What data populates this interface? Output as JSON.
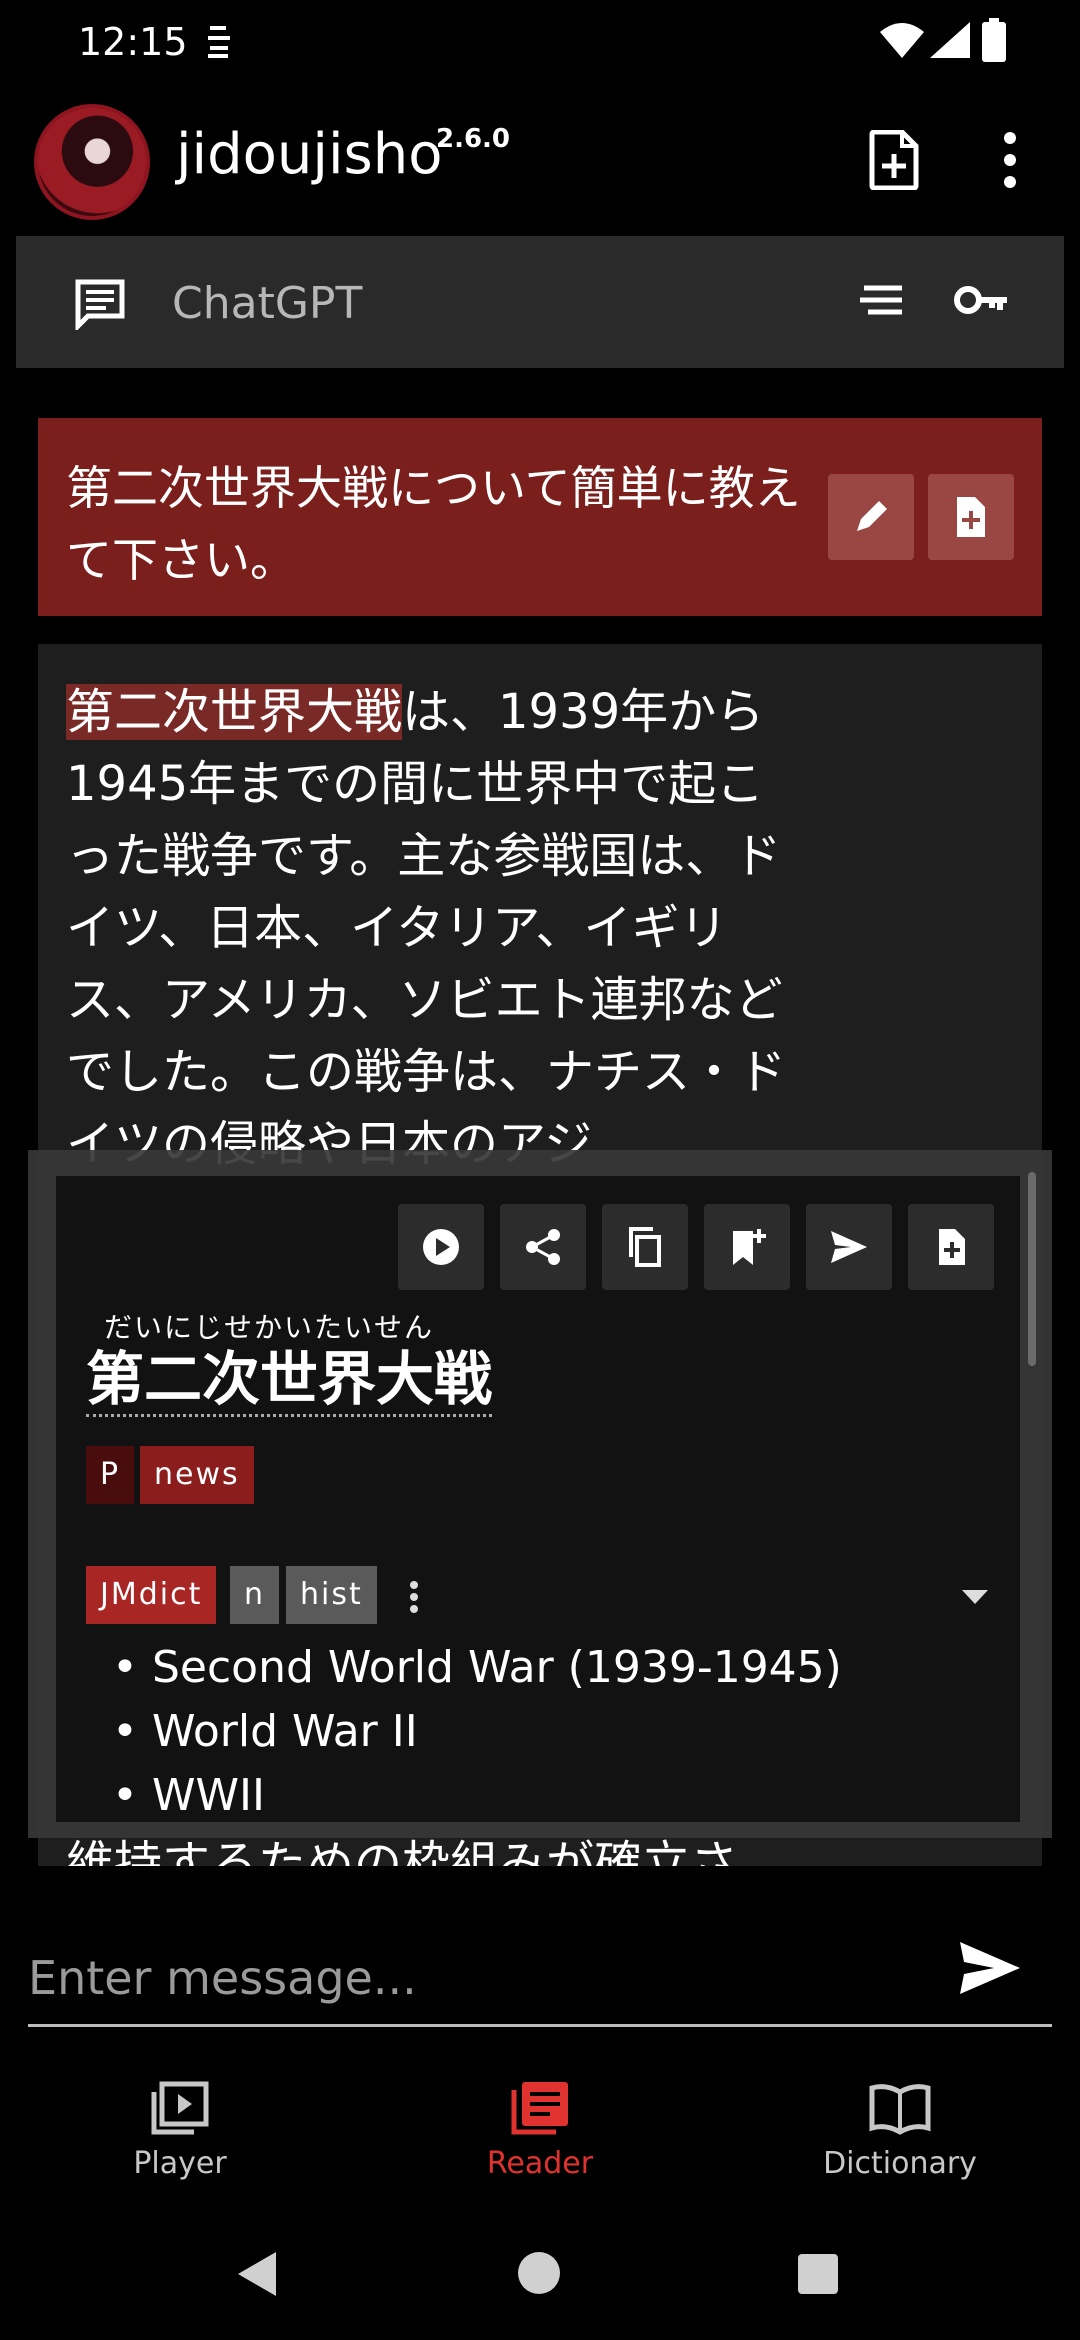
{
  "status_bar": {
    "time": "12:15"
  },
  "app_bar": {
    "title": "jidoujisho",
    "version": "2.6.0"
  },
  "chat_header": {
    "title": "ChatGPT"
  },
  "user_message": {
    "text": "第二次世界大戦について簡単に教えて下さい。"
  },
  "response": {
    "highlight": "第二次世界大戦",
    "text": "は、1939年から1945年までの間に世界中で起こった戦争です。主な参戦国は、ドイツ、日本、イタリア、イギリス、アメリカ、ソビエト連邦などでした。この戦争は、ナチス・ドイツの侵略や日本のアジ",
    "bottom_text": "維持するための枠組みが確立さ"
  },
  "dictionary_popup": {
    "reading": "だいにじせかいたいせん",
    "headword": "第二次世界大戦",
    "frequency_tags": [
      "P",
      "news"
    ],
    "dictionary_tags": [
      "JMdict",
      "n",
      "hist"
    ],
    "glosses": [
      "Second World War (1939-1945)",
      "World War II",
      "WWII"
    ]
  },
  "input": {
    "placeholder": "Enter message..."
  },
  "bottom_nav": {
    "items": [
      {
        "label": "Player",
        "icon": "player-icon"
      },
      {
        "label": "Reader",
        "icon": "reader-icon",
        "active": true
      },
      {
        "label": "Dictionary",
        "icon": "dictionary-icon"
      }
    ]
  },
  "colors": {
    "accent": "#e0322f",
    "user_bubble": "#7a1f1c",
    "panel": "#2a2a2a"
  }
}
